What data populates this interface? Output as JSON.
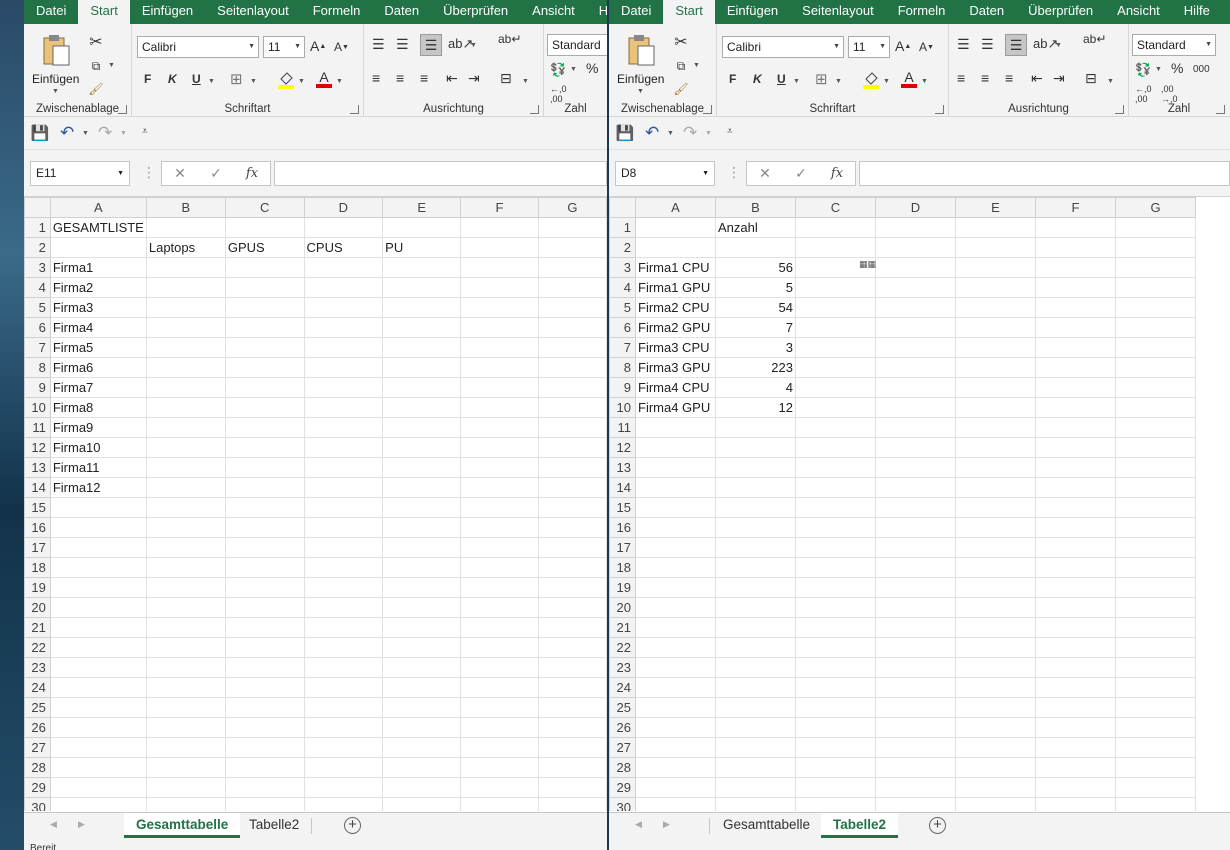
{
  "left": {
    "tabs": [
      "Datei",
      "Start",
      "Einfügen",
      "Seitenlayout",
      "Formeln",
      "Daten",
      "Überprüfen",
      "Ansicht",
      "H"
    ],
    "active_tab": "Start",
    "ribbon": {
      "clipboard_label": "Zwischenablage",
      "paste_label": "Einfügen",
      "font_label": "Schriftart",
      "align_label": "Ausrichtung",
      "number_label": "Zahl",
      "font_name": "Calibri",
      "font_size": "11",
      "number_format": "Standard",
      "bold": "F",
      "italic": "K",
      "underline": "U"
    },
    "name_box": "E11",
    "columns": [
      "A",
      "B",
      "C",
      "D",
      "E",
      "F",
      "G"
    ],
    "rows": [
      [
        "GESAMTLISTE",
        "",
        "",
        "",
        "",
        "",
        ""
      ],
      [
        "",
        "Laptops",
        "GPUS",
        "CPUS",
        "PU",
        "",
        ""
      ],
      [
        "Firma1",
        "",
        "",
        "",
        "",
        "",
        ""
      ],
      [
        "Firma2",
        "",
        "",
        "",
        "",
        "",
        ""
      ],
      [
        "Firma3",
        "",
        "",
        "",
        "",
        "",
        ""
      ],
      [
        "Firma4",
        "",
        "",
        "",
        "",
        "",
        ""
      ],
      [
        "Firma5",
        "",
        "",
        "",
        "",
        "",
        ""
      ],
      [
        "Firma6",
        "",
        "",
        "",
        "",
        "",
        ""
      ],
      [
        "Firma7",
        "",
        "",
        "",
        "",
        "",
        ""
      ],
      [
        "Firma8",
        "",
        "",
        "",
        "",
        "",
        ""
      ],
      [
        "Firma9",
        "",
        "",
        "",
        "",
        "",
        ""
      ],
      [
        "Firma10",
        "",
        "",
        "",
        "",
        "",
        ""
      ],
      [
        "Firma11",
        "",
        "",
        "",
        "",
        "",
        ""
      ],
      [
        "Firma12",
        "",
        "",
        "",
        "",
        "",
        ""
      ]
    ],
    "sheet_tabs": [
      "Gesamttabelle",
      "Tabelle2"
    ],
    "active_sheet": "Gesamttabelle"
  },
  "right": {
    "tabs": [
      "Datei",
      "Start",
      "Einfügen",
      "Seitenlayout",
      "Formeln",
      "Daten",
      "Überprüfen",
      "Ansicht",
      "Hilfe"
    ],
    "active_tab": "Start",
    "ribbon": {
      "clipboard_label": "Zwischenablage",
      "paste_label": "Einfügen",
      "font_label": "Schriftart",
      "align_label": "Ausrichtung",
      "number_label": "Zahl",
      "font_name": "Calibri",
      "font_size": "11",
      "number_format": "Standard",
      "bold": "F",
      "italic": "K",
      "underline": "U"
    },
    "name_box": "D8",
    "columns": [
      "A",
      "B",
      "C",
      "D",
      "E",
      "F",
      "G"
    ],
    "rows": [
      [
        "",
        "Anzahl",
        "",
        "",
        "",
        "",
        ""
      ],
      [
        "",
        "",
        "",
        "",
        "",
        "",
        ""
      ],
      [
        "Firma1 CPU",
        "56",
        "",
        "",
        "",
        "",
        ""
      ],
      [
        "Firma1 GPU",
        "5",
        "",
        "",
        "",
        "",
        ""
      ],
      [
        "Firma2 CPU",
        "54",
        "",
        "",
        "",
        "",
        ""
      ],
      [
        "Firma2 GPU",
        "7",
        "",
        "",
        "",
        "",
        ""
      ],
      [
        "Firma3 CPU",
        "3",
        "",
        "",
        "",
        "",
        ""
      ],
      [
        "Firma3 GPU",
        "223",
        "",
        "",
        "",
        "",
        ""
      ],
      [
        "Firma4 CPU",
        "4",
        "",
        "",
        "",
        "",
        ""
      ],
      [
        "Firma4 GPU",
        "12",
        "",
        "",
        "",
        "",
        ""
      ]
    ],
    "sheet_tabs": [
      "Gesamttabelle",
      "Tabelle2"
    ],
    "active_sheet": "Tabelle2"
  },
  "status_text": "Bereit",
  "total_rows": 30
}
